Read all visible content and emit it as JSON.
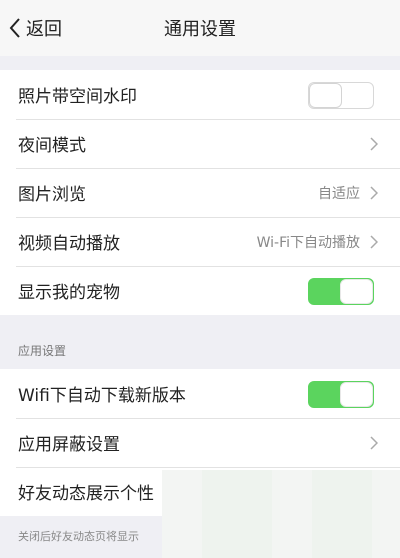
{
  "nav": {
    "back_label": "返回",
    "title": "通用设置"
  },
  "general": {
    "watermark_label": "照片带空间水印",
    "night_mode_label": "夜间模式",
    "image_browse_label": "图片浏览",
    "image_browse_value": "自适应",
    "video_autoplay_label": "视频自动播放",
    "video_autoplay_value": "Wi-Fi下自动播放",
    "show_pet_label": "显示我的宠物"
  },
  "app_settings": {
    "section_title": "应用设置",
    "wifi_update_label": "Wifi下自动下载新版本",
    "block_settings_label": "应用屏蔽设置",
    "friend_feed_label": "好友动态展示个性"
  },
  "footer": {
    "note": "关闭后好友动态页将显示"
  },
  "toggles": {
    "watermark": "off",
    "show_pet": "on",
    "wifi_update": "on"
  },
  "colors": {
    "toggle_on": "#5bd45e",
    "background": "#efeff4"
  }
}
